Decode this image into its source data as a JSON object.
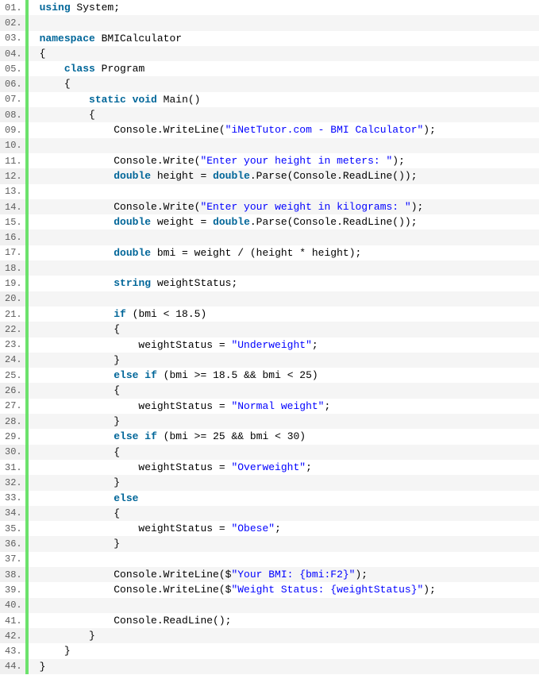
{
  "lines": [
    {
      "n": "01.",
      "tokens": [
        {
          "c": "kw",
          "t": "using"
        },
        {
          "c": "plain",
          "t": " System;"
        }
      ]
    },
    {
      "n": "02.",
      "tokens": []
    },
    {
      "n": "03.",
      "tokens": [
        {
          "c": "kw",
          "t": "namespace"
        },
        {
          "c": "plain",
          "t": " BMICalculator"
        }
      ]
    },
    {
      "n": "04.",
      "tokens": [
        {
          "c": "plain",
          "t": "{"
        }
      ]
    },
    {
      "n": "05.",
      "tokens": [
        {
          "c": "plain",
          "t": "    "
        },
        {
          "c": "kw",
          "t": "class"
        },
        {
          "c": "plain",
          "t": " Program"
        }
      ]
    },
    {
      "n": "06.",
      "tokens": [
        {
          "c": "plain",
          "t": "    {"
        }
      ]
    },
    {
      "n": "07.",
      "tokens": [
        {
          "c": "plain",
          "t": "        "
        },
        {
          "c": "kw",
          "t": "static"
        },
        {
          "c": "plain",
          "t": " "
        },
        {
          "c": "kw",
          "t": "void"
        },
        {
          "c": "plain",
          "t": " Main()"
        }
      ]
    },
    {
      "n": "08.",
      "tokens": [
        {
          "c": "plain",
          "t": "        {"
        }
      ]
    },
    {
      "n": "09.",
      "tokens": [
        {
          "c": "plain",
          "t": "            Console.WriteLine("
        },
        {
          "c": "str",
          "t": "\"iNetTutor.com - BMI Calculator\""
        },
        {
          "c": "plain",
          "t": ");"
        }
      ]
    },
    {
      "n": "10.",
      "tokens": []
    },
    {
      "n": "11.",
      "tokens": [
        {
          "c": "plain",
          "t": "            Console.Write("
        },
        {
          "c": "str",
          "t": "\"Enter your height in meters: \""
        },
        {
          "c": "plain",
          "t": ");"
        }
      ]
    },
    {
      "n": "12.",
      "tokens": [
        {
          "c": "plain",
          "t": "            "
        },
        {
          "c": "kw",
          "t": "double"
        },
        {
          "c": "plain",
          "t": " height = "
        },
        {
          "c": "kw",
          "t": "double"
        },
        {
          "c": "plain",
          "t": ".Parse(Console.ReadLine());"
        }
      ]
    },
    {
      "n": "13.",
      "tokens": []
    },
    {
      "n": "14.",
      "tokens": [
        {
          "c": "plain",
          "t": "            Console.Write("
        },
        {
          "c": "str",
          "t": "\"Enter your weight in kilograms: \""
        },
        {
          "c": "plain",
          "t": ");"
        }
      ]
    },
    {
      "n": "15.",
      "tokens": [
        {
          "c": "plain",
          "t": "            "
        },
        {
          "c": "kw",
          "t": "double"
        },
        {
          "c": "plain",
          "t": " weight = "
        },
        {
          "c": "kw",
          "t": "double"
        },
        {
          "c": "plain",
          "t": ".Parse(Console.ReadLine());"
        }
      ]
    },
    {
      "n": "16.",
      "tokens": []
    },
    {
      "n": "17.",
      "tokens": [
        {
          "c": "plain",
          "t": "            "
        },
        {
          "c": "kw",
          "t": "double"
        },
        {
          "c": "plain",
          "t": " bmi = weight / (height * height);"
        }
      ]
    },
    {
      "n": "18.",
      "tokens": []
    },
    {
      "n": "19.",
      "tokens": [
        {
          "c": "plain",
          "t": "            "
        },
        {
          "c": "kw",
          "t": "string"
        },
        {
          "c": "plain",
          "t": " weightStatus;"
        }
      ]
    },
    {
      "n": "20.",
      "tokens": []
    },
    {
      "n": "21.",
      "tokens": [
        {
          "c": "plain",
          "t": "            "
        },
        {
          "c": "kw",
          "t": "if"
        },
        {
          "c": "plain",
          "t": " (bmi < 18.5)"
        }
      ]
    },
    {
      "n": "22.",
      "tokens": [
        {
          "c": "plain",
          "t": "            {"
        }
      ]
    },
    {
      "n": "23.",
      "tokens": [
        {
          "c": "plain",
          "t": "                weightStatus = "
        },
        {
          "c": "str",
          "t": "\"Underweight\""
        },
        {
          "c": "plain",
          "t": ";"
        }
      ]
    },
    {
      "n": "24.",
      "tokens": [
        {
          "c": "plain",
          "t": "            }"
        }
      ]
    },
    {
      "n": "25.",
      "tokens": [
        {
          "c": "plain",
          "t": "            "
        },
        {
          "c": "kw",
          "t": "else"
        },
        {
          "c": "plain",
          "t": " "
        },
        {
          "c": "kw",
          "t": "if"
        },
        {
          "c": "plain",
          "t": " (bmi >= 18.5 && bmi < 25)"
        }
      ]
    },
    {
      "n": "26.",
      "tokens": [
        {
          "c": "plain",
          "t": "            {"
        }
      ]
    },
    {
      "n": "27.",
      "tokens": [
        {
          "c": "plain",
          "t": "                weightStatus = "
        },
        {
          "c": "str",
          "t": "\"Normal weight\""
        },
        {
          "c": "plain",
          "t": ";"
        }
      ]
    },
    {
      "n": "28.",
      "tokens": [
        {
          "c": "plain",
          "t": "            }"
        }
      ]
    },
    {
      "n": "29.",
      "tokens": [
        {
          "c": "plain",
          "t": "            "
        },
        {
          "c": "kw",
          "t": "else"
        },
        {
          "c": "plain",
          "t": " "
        },
        {
          "c": "kw",
          "t": "if"
        },
        {
          "c": "plain",
          "t": " (bmi >= 25 && bmi < 30)"
        }
      ]
    },
    {
      "n": "30.",
      "tokens": [
        {
          "c": "plain",
          "t": "            {"
        }
      ]
    },
    {
      "n": "31.",
      "tokens": [
        {
          "c": "plain",
          "t": "                weightStatus = "
        },
        {
          "c": "str",
          "t": "\"Overweight\""
        },
        {
          "c": "plain",
          "t": ";"
        }
      ]
    },
    {
      "n": "32.",
      "tokens": [
        {
          "c": "plain",
          "t": "            }"
        }
      ]
    },
    {
      "n": "33.",
      "tokens": [
        {
          "c": "plain",
          "t": "            "
        },
        {
          "c": "kw",
          "t": "else"
        }
      ]
    },
    {
      "n": "34.",
      "tokens": [
        {
          "c": "plain",
          "t": "            {"
        }
      ]
    },
    {
      "n": "35.",
      "tokens": [
        {
          "c": "plain",
          "t": "                weightStatus = "
        },
        {
          "c": "str",
          "t": "\"Obese\""
        },
        {
          "c": "plain",
          "t": ";"
        }
      ]
    },
    {
      "n": "36.",
      "tokens": [
        {
          "c": "plain",
          "t": "            }"
        }
      ]
    },
    {
      "n": "37.",
      "tokens": []
    },
    {
      "n": "38.",
      "tokens": [
        {
          "c": "plain",
          "t": "            Console.WriteLine($"
        },
        {
          "c": "str",
          "t": "\"Your BMI: {bmi:F2}\""
        },
        {
          "c": "plain",
          "t": ");"
        }
      ]
    },
    {
      "n": "39.",
      "tokens": [
        {
          "c": "plain",
          "t": "            Console.WriteLine($"
        },
        {
          "c": "str",
          "t": "\"Weight Status: {weightStatus}\""
        },
        {
          "c": "plain",
          "t": ");"
        }
      ]
    },
    {
      "n": "40.",
      "tokens": []
    },
    {
      "n": "41.",
      "tokens": [
        {
          "c": "plain",
          "t": "            Console.ReadLine();"
        }
      ]
    },
    {
      "n": "42.",
      "tokens": [
        {
          "c": "plain",
          "t": "        }"
        }
      ]
    },
    {
      "n": "43.",
      "tokens": [
        {
          "c": "plain",
          "t": "    }"
        }
      ]
    },
    {
      "n": "44.",
      "tokens": [
        {
          "c": "plain",
          "t": "}"
        }
      ]
    }
  ]
}
